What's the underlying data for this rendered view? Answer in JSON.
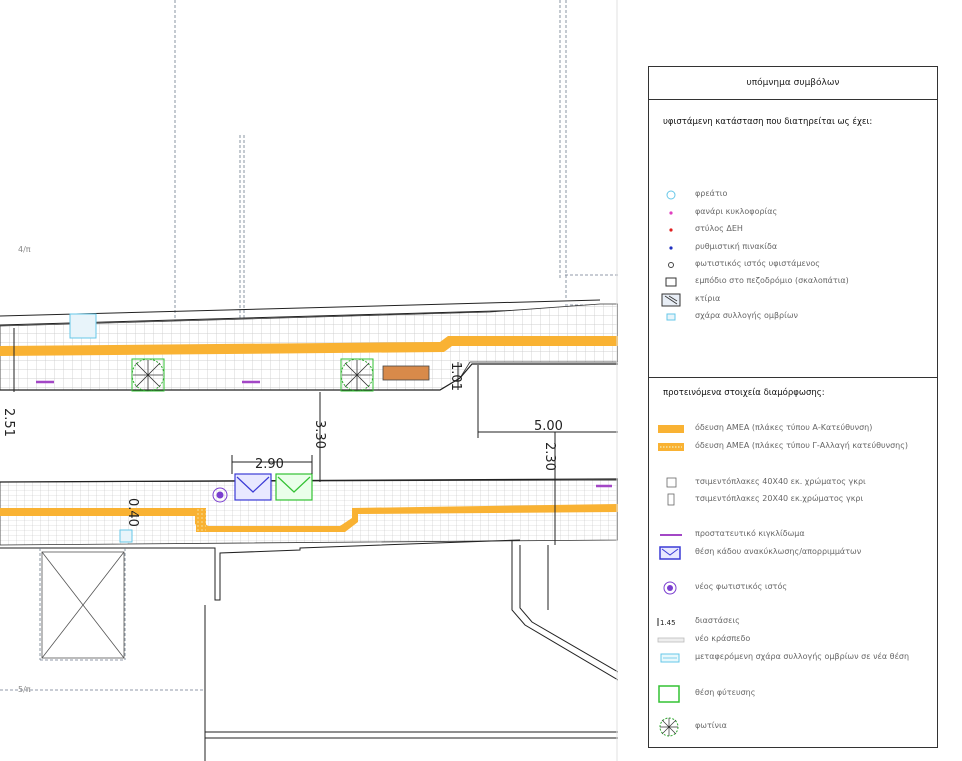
{
  "plan": {
    "block_label_top": "4/π",
    "block_label_bottom": "5/π",
    "dimensions": {
      "sidewalk_width_left": "2.51",
      "road_gap": "3.30",
      "bin_span": "2.90",
      "curb_small": "1.01",
      "road_width": "5.00",
      "sidewalk_width_right": "2.30",
      "sidewalk_small": "0.40"
    }
  },
  "legend": {
    "title": "υπόμνημα συμβόλων",
    "section_existing": {
      "heading": "υφιστάμενη κατάσταση που διατηρείται ως έχει:",
      "items": [
        {
          "label": "φρεάτιο",
          "icon": "manhole-icon"
        },
        {
          "label": "φανάρι κυκλοφορίας",
          "icon": "traffic-light-icon"
        },
        {
          "label": "στύλος ΔΕΗ",
          "icon": "power-pole-icon"
        },
        {
          "label": "ρυθμιστική πινακίδα",
          "icon": "traffic-sign-icon"
        },
        {
          "label": "φωτιστικός ιστός υφιστάμενος",
          "icon": "existing-lamp-icon"
        },
        {
          "label": "εμπόδιο στο πεζοδρόμιο (σκαλοπάτια)",
          "icon": "steps-obstacle-icon"
        },
        {
          "label": "κτίρια",
          "icon": "building-icon"
        },
        {
          "label": "σχάρα συλλογής ομβρίων",
          "icon": "drain-grate-icon"
        }
      ]
    },
    "section_proposed": {
      "heading": "προτεινόμενα στοιχεία διαμόρφωσης:",
      "items": [
        {
          "label": "όδευση ΑΜΕΑ (πλάκες τύπου Α-Κατεύθυνση)",
          "icon": "tactile-direction-icon"
        },
        {
          "label": "όδευση ΑΜΕΑ (πλάκες τύπου Γ-Αλλαγή κατεύθυνσης)",
          "icon": "tactile-change-icon"
        },
        {
          "label": "τσιμεντόπλακες 40Χ40 εκ. χρώματος γκρι",
          "icon": "tile-40-icon"
        },
        {
          "label": "τσιμεντόπλακες 20Χ40 εκ.χρώματος γκρι",
          "icon": "tile-20-icon"
        },
        {
          "label": "προστατευτικό κιγκλίδωμα",
          "icon": "railing-icon"
        },
        {
          "label": "θέση κάδου ανακύκλωσης/απορριμμάτων",
          "icon": "recycle-bin-icon"
        },
        {
          "label": "νέος φωτιστικός ιστός",
          "icon": "new-lamp-icon"
        },
        {
          "label": "διαστάσεις",
          "icon": "dimension-icon",
          "sample": "1.45"
        },
        {
          "label": "νέο κράσπεδο",
          "icon": "new-curb-icon"
        },
        {
          "label": "μεταφερόμενη σχάρα συλλογής ομβρίων σε νέα θέση",
          "icon": "relocated-grate-icon"
        },
        {
          "label": "θέση φύτευσης",
          "icon": "planting-spot-icon"
        },
        {
          "label": "φωτίνια",
          "icon": "photinia-icon"
        }
      ]
    }
  },
  "colors": {
    "tactile": "#f9b233",
    "tile_grid": "#c8c8c8",
    "railing": "#a347c6",
    "bin_blue": "#3b3bd6",
    "bin_green": "#33c233",
    "lamp": "#7b3fd0",
    "manhole": "#66c7e8",
    "traffic_light": "#e040c0",
    "power_pole": "#e02020",
    "sign": "#2030c0",
    "bench": "#d88a4a"
  }
}
